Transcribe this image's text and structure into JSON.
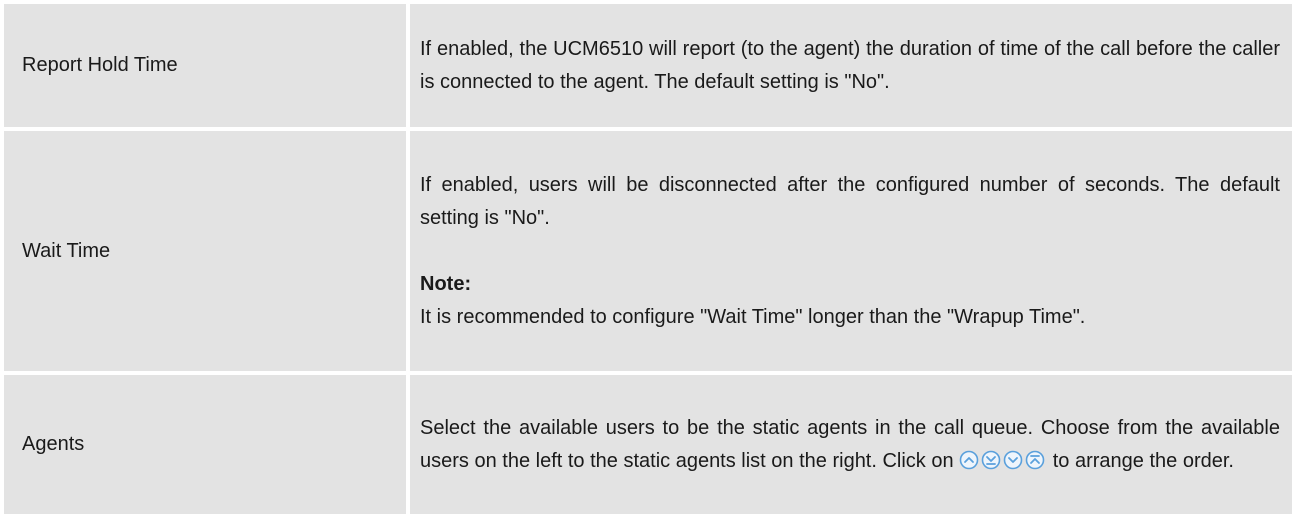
{
  "rows": [
    {
      "name": "Report Hold Time",
      "description": "If enabled, the UCM6510 will report (to the agent) the duration of time of the call before the caller is connected to the agent. The default setting is \"No\"."
    },
    {
      "name": "Wait Time",
      "description": "If enabled, users will be disconnected after the configured number of seconds. The default setting is \"No\".",
      "note_label": "Note:",
      "note_text": "It is recommended to configure \"Wait Time\" longer than the \"Wrapup Time\"."
    },
    {
      "name": "Agents",
      "description_before_icons": "Select the available users to be the static agents in the call queue. Choose from the available users on the left to the static agents list on the right. Click on",
      "description_after_icons": "to arrange the order.",
      "icons": [
        "move-up-icon",
        "move-down-icon",
        "move-down-one-icon",
        "move-top-icon"
      ]
    }
  ],
  "colors": {
    "cell_background": "#e3e3e3",
    "icon_stroke": "#5aa0dc"
  }
}
